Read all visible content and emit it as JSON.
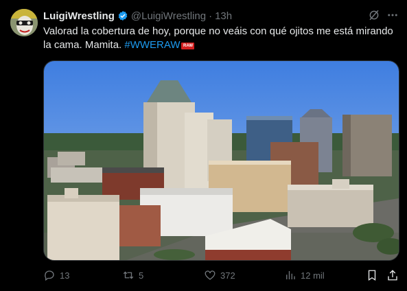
{
  "author": {
    "display_name": "LuigiWrestling",
    "handle": "@LuigiWrestling",
    "separator": "·",
    "time": "13h"
  },
  "tweet": {
    "text": "Valorad la cobertura de hoy, porque no veáis con qué ojitos me está mirando la cama. Mamita. ",
    "hashtag": "#WWERAW",
    "hashflag_text": "RAW"
  },
  "actions": {
    "replies": "13",
    "retweets": "5",
    "likes": "372",
    "views": "12 mil"
  },
  "icons": {
    "verified": "verified-badge-icon",
    "grok": "grok-icon",
    "more": "more-icon",
    "reply": "reply-icon",
    "retweet": "retweet-icon",
    "like": "heart-icon",
    "views": "views-icon",
    "bookmark": "bookmark-icon",
    "share": "share-icon"
  },
  "colors": {
    "background": "#000000",
    "text": "#e7e9ea",
    "muted": "#71767b",
    "accent": "#1d9bf0"
  }
}
